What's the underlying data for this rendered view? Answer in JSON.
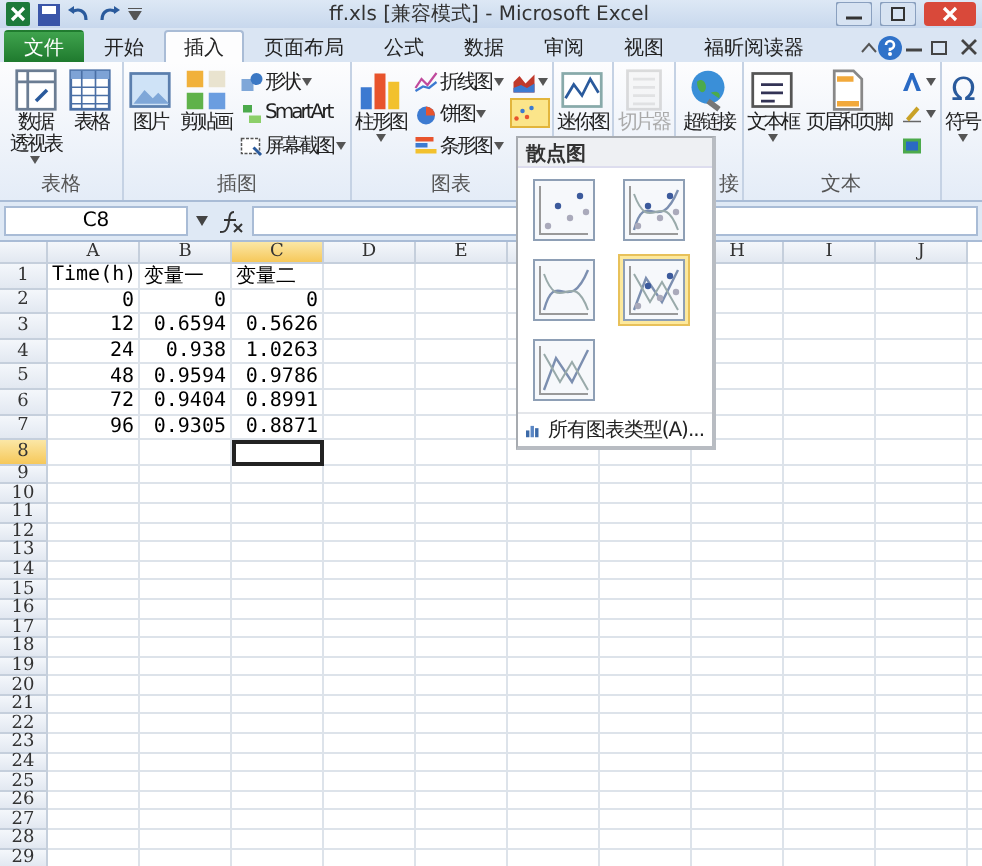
{
  "window": {
    "title": "ff.xls [兼容模式] - Microsoft Excel"
  },
  "tabs": [
    {
      "label": "文件",
      "kind": "file",
      "selected": false
    },
    {
      "label": "开始",
      "kind": "tab",
      "selected": false
    },
    {
      "label": "插入",
      "kind": "tab",
      "selected": true
    },
    {
      "label": "页面布局",
      "kind": "tab",
      "selected": false
    },
    {
      "label": "公式",
      "kind": "tab",
      "selected": false
    },
    {
      "label": "数据",
      "kind": "tab",
      "selected": false
    },
    {
      "label": "审阅",
      "kind": "tab",
      "selected": false
    },
    {
      "label": "视图",
      "kind": "tab",
      "selected": false
    },
    {
      "label": "福昕阅读器",
      "kind": "tab",
      "selected": false
    }
  ],
  "ribbon": [
    {
      "label": "表格",
      "buttons": [
        {
          "kind": "large",
          "lines": [
            "数据",
            "透视表"
          ],
          "dropdown": true,
          "disabled": false,
          "active": false
        },
        {
          "kind": "large",
          "lines": [
            "表格"
          ],
          "dropdown": false,
          "disabled": false,
          "active": false
        }
      ]
    },
    {
      "label": "插图",
      "buttons": [
        {
          "kind": "large",
          "lines": [
            "图片"
          ],
          "dropdown": false,
          "disabled": false,
          "active": false
        },
        {
          "kind": "large",
          "lines": [
            "剪贴画"
          ],
          "dropdown": false,
          "disabled": false,
          "active": false
        },
        {
          "kind": "small",
          "lines": [
            "形状"
          ],
          "dropdown": true,
          "disabled": false,
          "active": false
        },
        {
          "kind": "small",
          "lines": [
            "SmartArt"
          ],
          "dropdown": false,
          "disabled": false,
          "active": false
        },
        {
          "kind": "small",
          "lines": [
            "屏幕截图"
          ],
          "dropdown": true,
          "disabled": false,
          "active": false
        }
      ]
    },
    {
      "label": "图表",
      "buttons": [
        {
          "kind": "large",
          "lines": [
            "柱形图"
          ],
          "dropdown": true,
          "disabled": false,
          "active": false
        },
        {
          "kind": "small",
          "lines": [
            "折线图"
          ],
          "dropdown": true,
          "disabled": false,
          "active": false
        },
        {
          "kind": "small",
          "lines": [
            "饼图"
          ],
          "dropdown": true,
          "disabled": false,
          "active": false
        },
        {
          "kind": "small",
          "lines": [
            "条形图"
          ],
          "dropdown": true,
          "disabled": false,
          "active": false
        },
        {
          "kind": "icon",
          "dropdown": true,
          "disabled": false,
          "active": false
        },
        {
          "kind": "icon",
          "dropdown": false,
          "disabled": false,
          "active": true
        }
      ]
    },
    {
      "buttons": [
        {
          "kind": "large",
          "lines": [
            "迷你图"
          ],
          "dropdown": false,
          "disabled": false,
          "active": false
        }
      ]
    },
    {
      "buttons": [
        {
          "kind": "large",
          "lines": [
            "切片器"
          ],
          "dropdown": false,
          "disabled": true,
          "active": false
        }
      ]
    },
    {
      "label": "接",
      "buttons": [
        {
          "kind": "large",
          "lines": [
            "超链接"
          ],
          "dropdown": false,
          "disabled": false,
          "active": false
        }
      ]
    },
    {
      "label": "文本",
      "buttons": [
        {
          "kind": "large",
          "lines": [
            "文本框"
          ],
          "dropdown": true,
          "disabled": false,
          "active": false
        },
        {
          "kind": "large",
          "lines": [
            "页眉和页脚"
          ],
          "dropdown": false,
          "disabled": false,
          "active": false
        },
        {
          "kind": "icon",
          "dropdown": true,
          "disabled": false,
          "active": false
        },
        {
          "kind": "icon",
          "dropdown": true,
          "disabled": false,
          "active": false
        },
        {
          "kind": "icon",
          "dropdown": false,
          "disabled": false,
          "active": false
        }
      ]
    },
    {
      "buttons": [
        {
          "kind": "large",
          "glyph": "Ω",
          "lines": [
            "符号"
          ],
          "dropdown": true,
          "disabled": false,
          "active": false
        }
      ]
    }
  ],
  "formula_bar": {
    "name_box": "C8"
  },
  "sheet": {
    "columns": [
      {
        "label": "A",
        "selected": false
      },
      {
        "label": "B",
        "selected": false
      },
      {
        "label": "C",
        "selected": true
      },
      {
        "label": "D",
        "selected": false
      },
      {
        "label": "E",
        "selected": false
      },
      {
        "label": "H",
        "selected": false
      },
      {
        "label": "I",
        "selected": false
      },
      {
        "label": "J",
        "selected": false
      }
    ],
    "rows": [
      {
        "header": "1",
        "kind": "text",
        "selected": false,
        "cells": [
          "Time(h)",
          "变量一",
          "变量二"
        ]
      },
      {
        "header": "2",
        "kind": "number",
        "selected": false,
        "cells": [
          "0",
          "0",
          "0"
        ]
      },
      {
        "header": "3",
        "kind": "number",
        "selected": false,
        "cells": [
          "12",
          "0.6594",
          "0.5626"
        ]
      },
      {
        "header": "4",
        "kind": "number",
        "selected": false,
        "cells": [
          "24",
          "0.938",
          "1.0263"
        ]
      },
      {
        "header": "5",
        "kind": "number",
        "selected": false,
        "cells": [
          "48",
          "0.9594",
          "0.9786"
        ]
      },
      {
        "header": "6",
        "kind": "number",
        "selected": false,
        "cells": [
          "72",
          "0.9404",
          "0.8991"
        ]
      },
      {
        "header": "7",
        "kind": "number",
        "selected": false,
        "cells": [
          "96",
          "0.9305",
          "0.8871"
        ]
      },
      {
        "header": "8",
        "kind": "number",
        "selected": true,
        "cells": []
      },
      {
        "header": "9",
        "kind": "number",
        "selected": false,
        "cells": []
      },
      {
        "header": "10",
        "kind": "number",
        "selected": false,
        "cells": []
      },
      {
        "header": "11",
        "kind": "number",
        "selected": false,
        "cells": []
      },
      {
        "header": "12",
        "kind": "number",
        "selected": false,
        "cells": []
      },
      {
        "header": "13",
        "kind": "number",
        "selected": false,
        "cells": []
      },
      {
        "header": "14",
        "kind": "number",
        "selected": false,
        "cells": []
      },
      {
        "header": "15",
        "kind": "number",
        "selected": false,
        "cells": []
      },
      {
        "header": "16",
        "kind": "number",
        "selected": false,
        "cells": []
      },
      {
        "header": "17",
        "kind": "number",
        "selected": false,
        "cells": []
      },
      {
        "header": "18",
        "kind": "number",
        "selected": false,
        "cells": []
      },
      {
        "header": "19",
        "kind": "number",
        "selected": false,
        "cells": []
      },
      {
        "header": "20",
        "kind": "number",
        "selected": false,
        "cells": []
      },
      {
        "header": "21",
        "kind": "number",
        "selected": false,
        "cells": []
      },
      {
        "header": "22",
        "kind": "number",
        "selected": false,
        "cells": []
      },
      {
        "header": "23",
        "kind": "number",
        "selected": false,
        "cells": []
      },
      {
        "header": "24",
        "kind": "number",
        "selected": false,
        "cells": []
      },
      {
        "header": "25",
        "kind": "number",
        "selected": false,
        "cells": []
      },
      {
        "header": "26",
        "kind": "number",
        "selected": false,
        "cells": []
      },
      {
        "header": "27",
        "kind": "number",
        "selected": false,
        "cells": []
      },
      {
        "header": "28",
        "kind": "number",
        "selected": false,
        "cells": []
      },
      {
        "header": "29",
        "kind": "number",
        "selected": false,
        "cells": []
      }
    ]
  },
  "scatter_menu": {
    "title": "散点图",
    "options": [
      {
        "kind": "markers",
        "selected": false
      },
      {
        "kind": "smooth-markers",
        "selected": false
      },
      {
        "kind": "smooth",
        "selected": false
      },
      {
        "kind": "straight-markers",
        "selected": true
      },
      {
        "kind": "straight",
        "selected": false
      }
    ],
    "footer": "所有图表类型(A)..."
  }
}
